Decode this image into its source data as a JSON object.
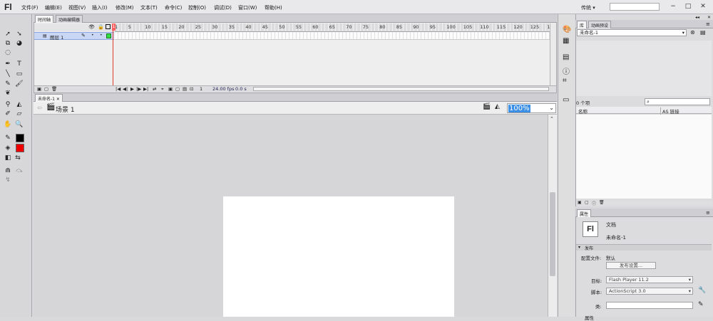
{
  "app": {
    "logo": "Fl",
    "menu": [
      "文件(F)",
      "编辑(E)",
      "视图(V)",
      "插入(I)",
      "修改(M)",
      "文本(T)",
      "命令(C)",
      "控制(O)",
      "调试(D)",
      "窗口(W)",
      "帮助(H)"
    ],
    "workspace": "传统",
    "window_controls": [
      "−",
      "□",
      "✕"
    ]
  },
  "timeline": {
    "tabs": [
      "时间轴",
      "动画编辑器"
    ],
    "layer_name": "图层 1",
    "ruler_numbers": [
      "1",
      "5",
      "10",
      "15",
      "20",
      "25",
      "30",
      "35",
      "40",
      "45",
      "50",
      "55",
      "60",
      "65",
      "70",
      "75",
      "80",
      "85",
      "90",
      "95",
      "100",
      "105",
      "110",
      "115",
      "120",
      "125",
      "130"
    ],
    "fps": "24.00 fps",
    "time": "0.0 s",
    "current_frame": "1"
  },
  "document": {
    "tab": "未命名-1",
    "scene": "场景 1",
    "zoom": "100%"
  },
  "library": {
    "tabs": [
      "库",
      "动画预设"
    ],
    "doc": "未命名-1",
    "count": "0 个项",
    "columns": [
      "名称",
      "AS 链接"
    ]
  },
  "properties": {
    "tab": "属性",
    "type": "文档",
    "name": "未命名-1",
    "section": "发布",
    "profile_label": "配置文件:",
    "profile_value": "默认",
    "publish_settings": "发布设置...",
    "target_label": "目标:",
    "target_value": "Flash Player 11.2",
    "script_label": "脚本:",
    "script_value": "ActionScript 3.0",
    "class_label": "类:",
    "class_value": "",
    "properties_label": "属性"
  },
  "colors": {
    "stroke": "#000000",
    "fill": "#ee0000",
    "playhead": "#e3382d",
    "zoom_highlight": "#3b8ee5"
  }
}
